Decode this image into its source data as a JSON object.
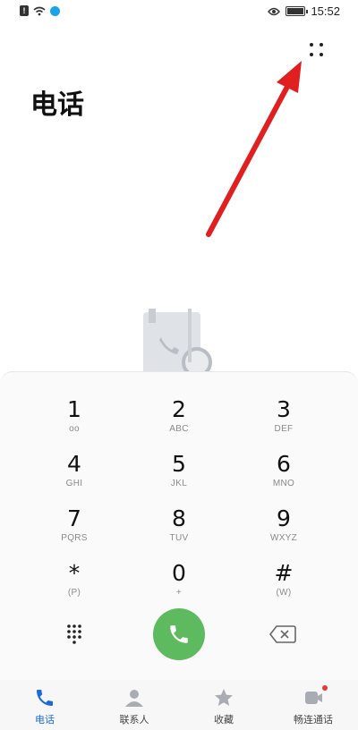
{
  "status_bar": {
    "time": "15:52"
  },
  "header": {
    "title": "电话",
    "more_icon": "more-dots-icon"
  },
  "dialpad": {
    "keys": [
      {
        "digit": "1",
        "sub": "oo"
      },
      {
        "digit": "2",
        "sub": "ABC"
      },
      {
        "digit": "3",
        "sub": "DEF"
      },
      {
        "digit": "4",
        "sub": "GHI"
      },
      {
        "digit": "5",
        "sub": "JKL"
      },
      {
        "digit": "6",
        "sub": "MNO"
      },
      {
        "digit": "7",
        "sub": "PQRS"
      },
      {
        "digit": "8",
        "sub": "TUV"
      },
      {
        "digit": "9",
        "sub": "WXYZ"
      },
      {
        "digit": "*",
        "sub": "(P)"
      },
      {
        "digit": "0",
        "sub": "+"
      },
      {
        "digit": "#",
        "sub": "(W)"
      }
    ],
    "call_color": "#5dba5f"
  },
  "bottom_nav": {
    "items": [
      {
        "label": "电话",
        "icon": "phone-icon",
        "active": true
      },
      {
        "label": "联系人",
        "icon": "contacts-icon",
        "active": false
      },
      {
        "label": "收藏",
        "icon": "star-icon",
        "active": false
      },
      {
        "label": "畅连通话",
        "icon": "meetime-icon",
        "active": false
      }
    ],
    "active_color": "#1a6be0"
  },
  "annotation": {
    "arrow_color": "#e02020"
  }
}
